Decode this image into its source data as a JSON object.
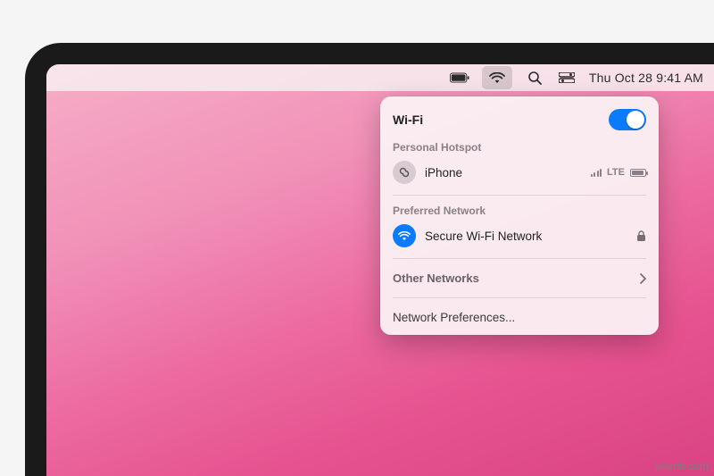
{
  "menubar": {
    "datetime": "Thu Oct 28  9:41 AM"
  },
  "wifi": {
    "title": "Wi-Fi",
    "enabled": true,
    "sections": {
      "hotspot_label": "Personal Hotspot",
      "hotspot": {
        "name": "iPhone",
        "carrier": "LTE"
      },
      "preferred_label": "Preferred Network",
      "preferred": {
        "name": "Secure Wi-Fi Network",
        "locked": true
      },
      "other_label": "Other Networks",
      "prefs_label": "Network Preferences..."
    }
  },
  "watermark": "wsxdn.com"
}
